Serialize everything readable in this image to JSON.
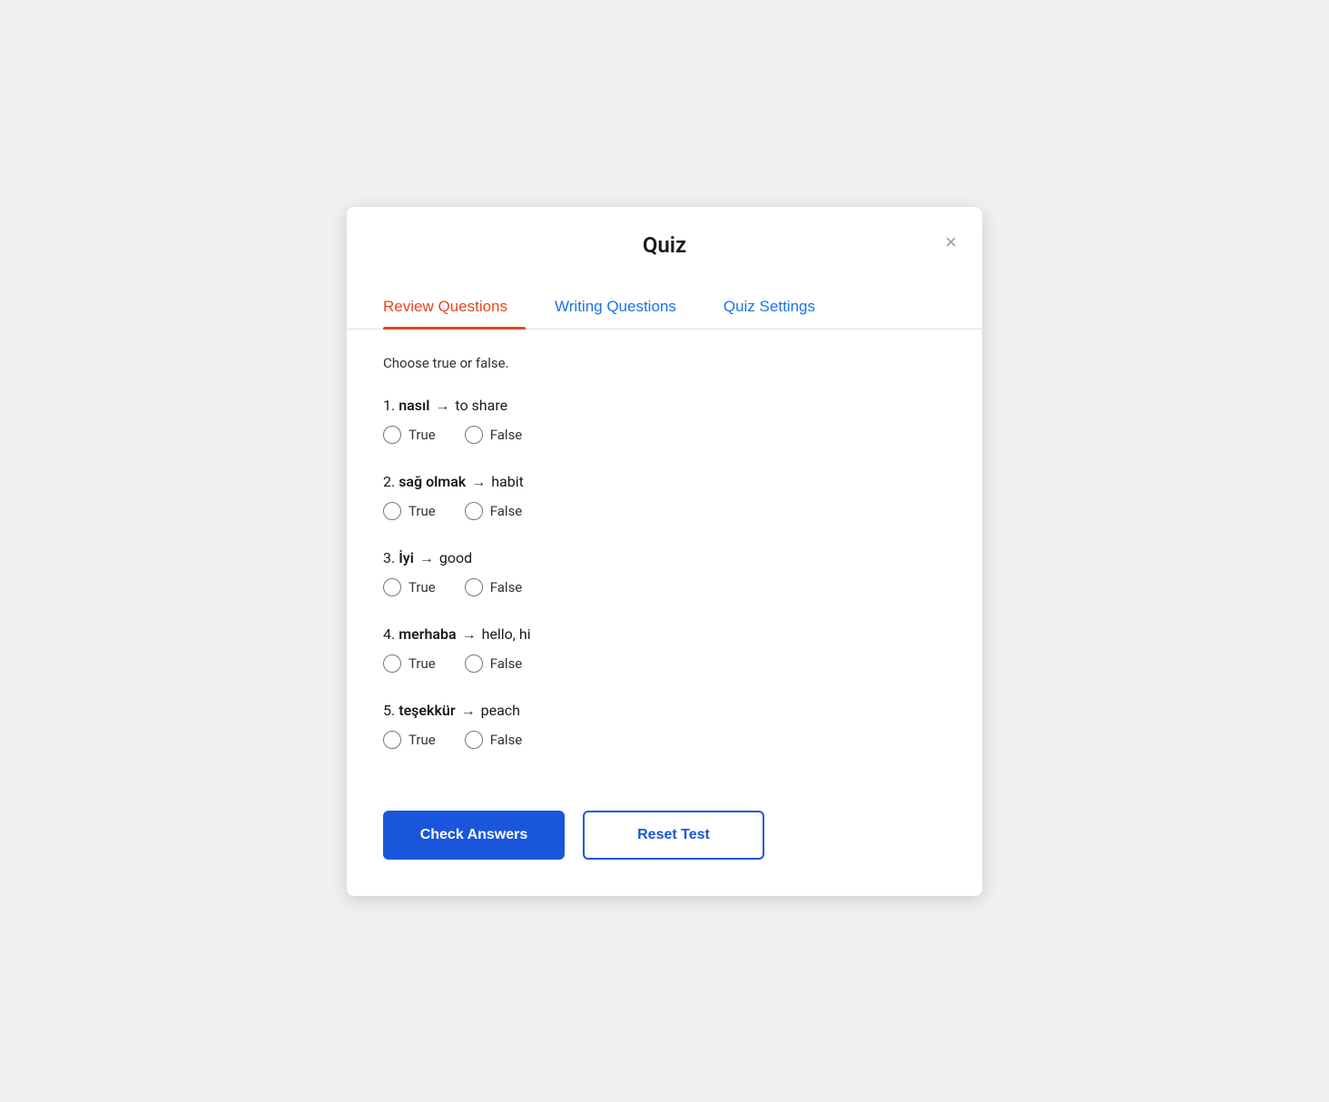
{
  "modal": {
    "title": "Quiz",
    "close_label": "×"
  },
  "tabs": [
    {
      "id": "review",
      "label": "Review Questions",
      "active": true
    },
    {
      "id": "writing",
      "label": "Writing Questions",
      "active": false
    },
    {
      "id": "settings",
      "label": "Quiz Settings",
      "active": false
    }
  ],
  "instruction": "Choose true or false.",
  "questions": [
    {
      "number": "1",
      "word": "nasıl",
      "arrow": "→",
      "translation": "to share"
    },
    {
      "number": "2",
      "word": "sağ olmak",
      "arrow": "→",
      "translation": "habit"
    },
    {
      "number": "3",
      "word": "İyi",
      "arrow": "→",
      "translation": "good"
    },
    {
      "number": "4",
      "word": "merhaba",
      "arrow": "→",
      "translation": "hello, hi"
    },
    {
      "number": "5",
      "word": "teşekkür",
      "arrow": "→",
      "translation": "peach"
    }
  ],
  "radio_options": [
    {
      "value": "true",
      "label": "True"
    },
    {
      "value": "false",
      "label": "False"
    }
  ],
  "buttons": {
    "check": "Check Answers",
    "reset": "Reset Test"
  }
}
